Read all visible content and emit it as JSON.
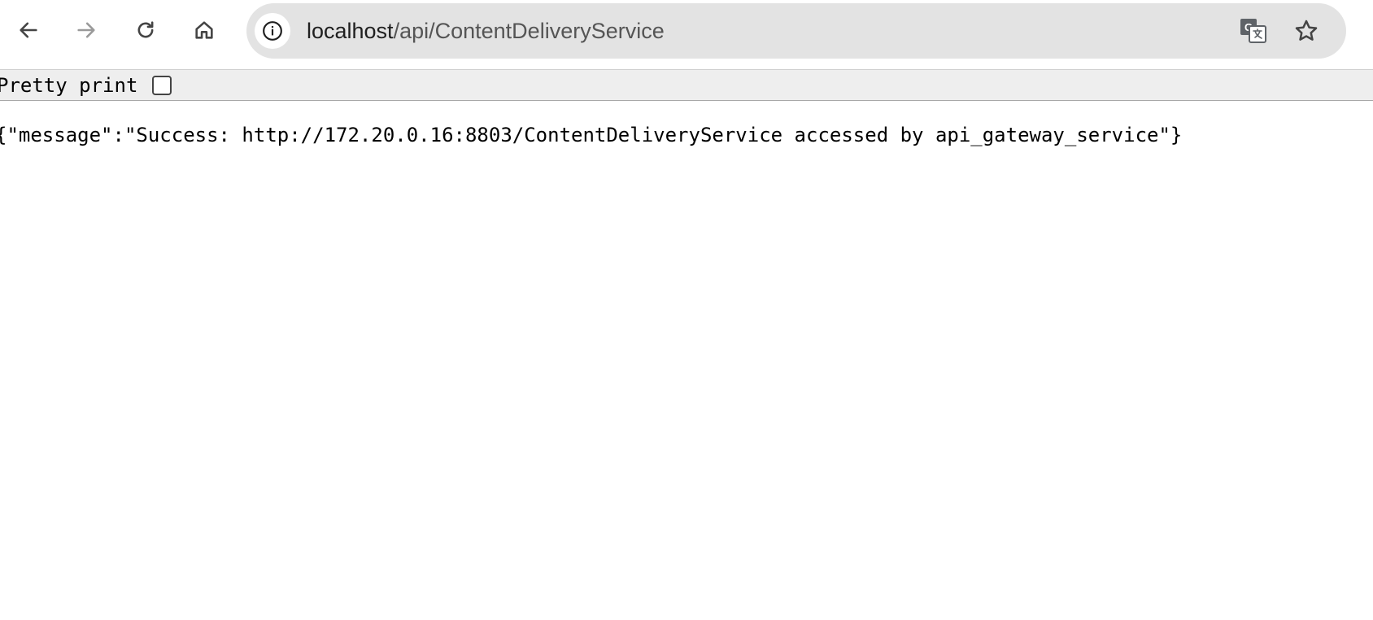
{
  "browser": {
    "back_icon": "arrow-left-icon",
    "forward_icon": "arrow-right-icon",
    "reload_icon": "reload-icon",
    "home_icon": "home-icon",
    "site_info_icon": "info-icon",
    "translate_icon": "translate-icon",
    "bookmark_icon": "star-icon",
    "url_host": "localhost",
    "url_path": "/api/ContentDeliveryService"
  },
  "viewer": {
    "pretty_print_label": "Pretty print",
    "pretty_print_checked": false
  },
  "response": {
    "raw_json": "{\"message\":\"Success: http://172.20.0.16:8803/ContentDeliveryService accessed by api_gateway_service\"}"
  },
  "colors": {
    "omnibox_bg": "#e3e3e3",
    "pretty_bar_bg": "#eeeeee",
    "icon_color": "#444444",
    "disabled_icon_color": "#9a9a9a"
  }
}
